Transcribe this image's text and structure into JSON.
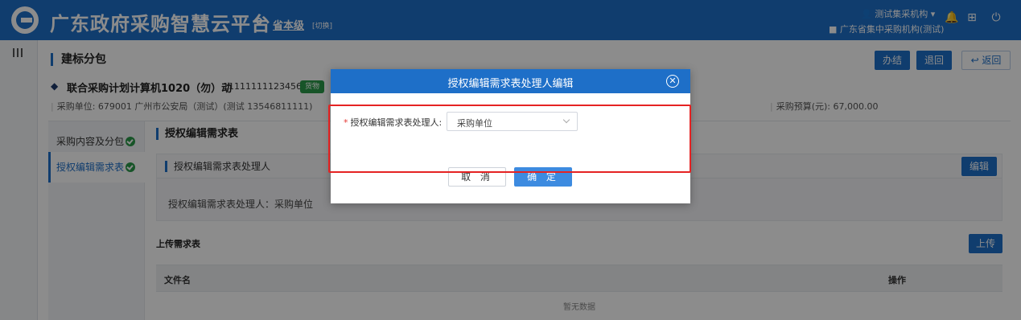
{
  "header": {
    "app_title": "广东政府采购智慧云平台",
    "location_level": "省本级",
    "location_switch": "[切换]",
    "user_name": "测试集采机构 ▾",
    "user_org": "广东省集中采购机构(测试)",
    "icons": [
      "user-icon",
      "notification-icon",
      "grid-icon",
      "power-icon"
    ]
  },
  "page": {
    "title": "建标分包",
    "buttons": {
      "handle": "办结",
      "back": "退回",
      "return": "↩ 返回"
    }
  },
  "project": {
    "name": "联合采购计划计算机1020（勿）动",
    "code": "11111111123456",
    "tag": "货物",
    "unit_line": "采购单位: 679001 广州市公安局（测试）(测试 13546811111)",
    "budget_line": "采购预算(元): 67,000.00"
  },
  "steps": [
    {
      "label": "采购内容及分包",
      "done": true
    },
    {
      "label": "授权编辑需求表",
      "done": true
    }
  ],
  "section": {
    "title": "授权编辑需求表",
    "card_title": "授权编辑需求表处理人",
    "edit_button": "编辑",
    "card_text": "授权编辑需求表处理人：采购单位"
  },
  "upload": {
    "title": "上传需求表",
    "upload_button": "上传",
    "columns": [
      "文件名",
      "操作"
    ],
    "empty_text": "暂无数据"
  },
  "modal": {
    "title": "授权编辑需求表处理人编辑",
    "field_required_mark": "*",
    "field_label": "授权编辑需求表处理人:",
    "field_value": "采购单位",
    "cancel": "取 消",
    "confirm": "确 定"
  },
  "colors": {
    "brand": "#1e6fc8",
    "success": "#2b9a4a",
    "highlight": "#e52323"
  }
}
